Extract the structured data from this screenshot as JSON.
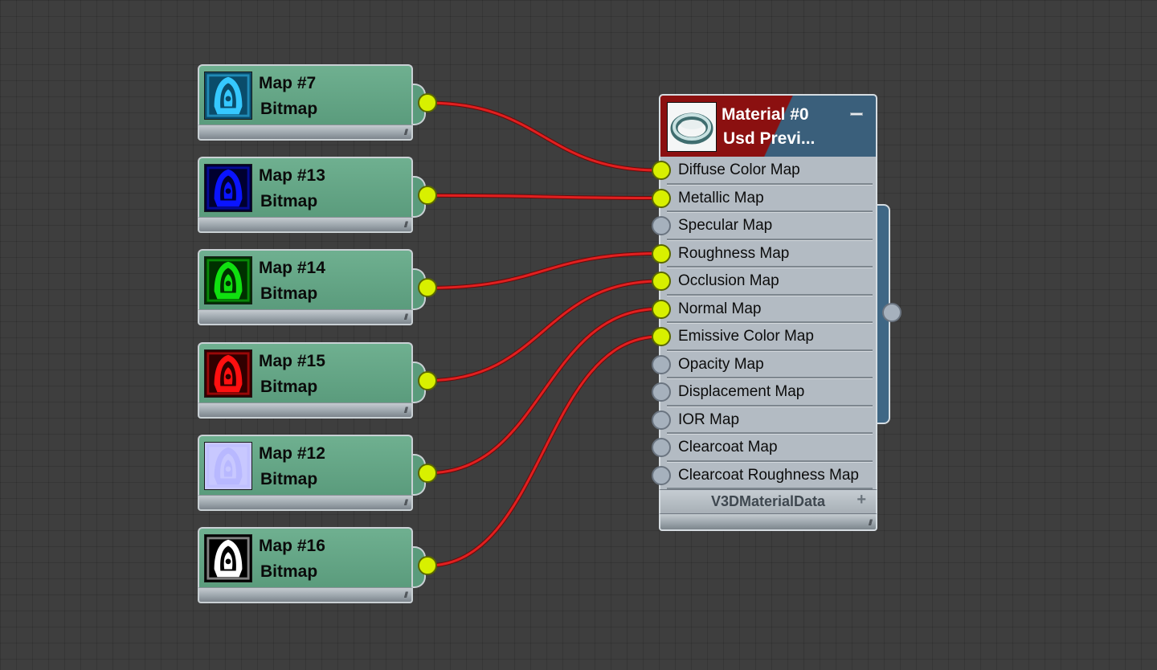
{
  "map_nodes": [
    {
      "name": "Map #7",
      "type": "Bitmap",
      "thumb_color": "#35c8ff",
      "thumb_bg": "#0a4c6a",
      "icon": "bitmap-thumbnail-icon"
    },
    {
      "name": "Map #13",
      "type": "Bitmap",
      "thumb_color": "#0a14ff",
      "thumb_bg": "#000030",
      "icon": "bitmap-thumbnail-icon"
    },
    {
      "name": "Map #14",
      "type": "Bitmap",
      "thumb_color": "#10e010",
      "thumb_bg": "#003000",
      "icon": "bitmap-thumbnail-icon"
    },
    {
      "name": "Map #15",
      "type": "Bitmap",
      "thumb_color": "#ff1010",
      "thumb_bg": "#300000",
      "icon": "bitmap-thumbnail-icon"
    },
    {
      "name": "Map #12",
      "type": "Bitmap",
      "thumb_color": "#b8b8ff",
      "thumb_bg": "#c8c8ff",
      "icon": "bitmap-thumbnail-icon"
    },
    {
      "name": "Map #16",
      "type": "Bitmap",
      "thumb_color": "#ffffff",
      "thumb_bg": "#000000",
      "icon": "bitmap-thumbnail-icon"
    }
  ],
  "material_node": {
    "name": "Material #0",
    "type": "Usd  Previ...",
    "section_label": "V3DMaterialData",
    "expand_symbol": "+",
    "header_color_left": "#8b1010",
    "header_color_right": "#3a5f7b",
    "slots": [
      {
        "label": "Diffuse Color Map",
        "connected": true
      },
      {
        "label": "Metallic Map",
        "connected": true
      },
      {
        "label": "Specular Map",
        "connected": false
      },
      {
        "label": "Roughness Map",
        "connected": true
      },
      {
        "label": "Occlusion Map",
        "connected": true
      },
      {
        "label": "Normal Map",
        "connected": true
      },
      {
        "label": "Emissive Color Map",
        "connected": true
      },
      {
        "label": "Opacity Map",
        "connected": false
      },
      {
        "label": "Displacement Map",
        "connected": false
      },
      {
        "label": "IOR Map",
        "connected": false
      },
      {
        "label": "Clearcoat Map",
        "connected": false
      },
      {
        "label": "Clearcoat Roughness Map",
        "connected": false
      }
    ]
  },
  "connections": [
    {
      "from": "Map #7",
      "to": "Diffuse Color Map"
    },
    {
      "from": "Map #13",
      "to": "Metallic Map"
    },
    {
      "from": "Map #14",
      "to": "Roughness Map"
    },
    {
      "from": "Map #15",
      "to": "Occlusion Map"
    },
    {
      "from": "Map #12",
      "to": "Normal Map"
    },
    {
      "from": "Map #16",
      "to": "Emissive Color Map"
    }
  ],
  "colors": {
    "wire": "#e02020",
    "socket_connected": "#d8f000",
    "socket_empty": "#a6b1bd",
    "map_node": "#5f9f80",
    "canvas": "#3e3e3e"
  }
}
